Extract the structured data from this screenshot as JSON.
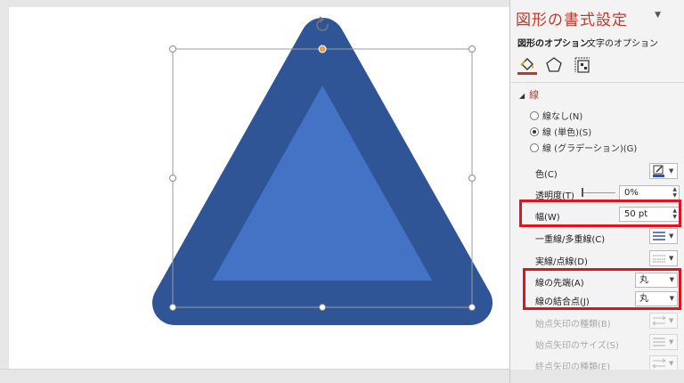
{
  "pane": {
    "title": "図形の書式設定",
    "dropdown_caret": "▼",
    "tabs": [
      {
        "label": "図形のオプション",
        "active": true
      },
      {
        "label": "文字のオプション",
        "active": false
      }
    ],
    "category_icons": [
      "fill-line-icon",
      "effects-pentagon-icon",
      "size-properties-icon"
    ],
    "section": {
      "label": "線",
      "expand_glyph": "◢"
    },
    "radios": [
      {
        "label": "線なし(N)",
        "selected": false
      },
      {
        "label": "線 (単色)(S)",
        "selected": true
      },
      {
        "label": "線 (グラデーション)(G)",
        "selected": false
      }
    ],
    "props": {
      "color_label": "色(C)",
      "transparency_label": "透明度(T)",
      "transparency_value": "0%",
      "width_label": "幅(W)",
      "width_value": "50 pt",
      "compound_label": "一重線/多重線(C)",
      "dash_label": "実線/点線(D)",
      "cap_label": "線の先端(A)",
      "cap_value": "丸",
      "join_label": "線の結合点(J)",
      "join_value": "丸",
      "begin_arrow_type_label": "始点矢印の種類(B)",
      "begin_arrow_size_label": "始点矢印のサイズ(S)",
      "end_arrow_type_label": "終点矢印の種類(E)"
    }
  },
  "colors": {
    "accent": "#c0392b",
    "shape_fill": "#4472c4",
    "shape_outline": "#2f5597",
    "highlight_box": "#e0141e",
    "handle_orange": "#e2a25c"
  }
}
